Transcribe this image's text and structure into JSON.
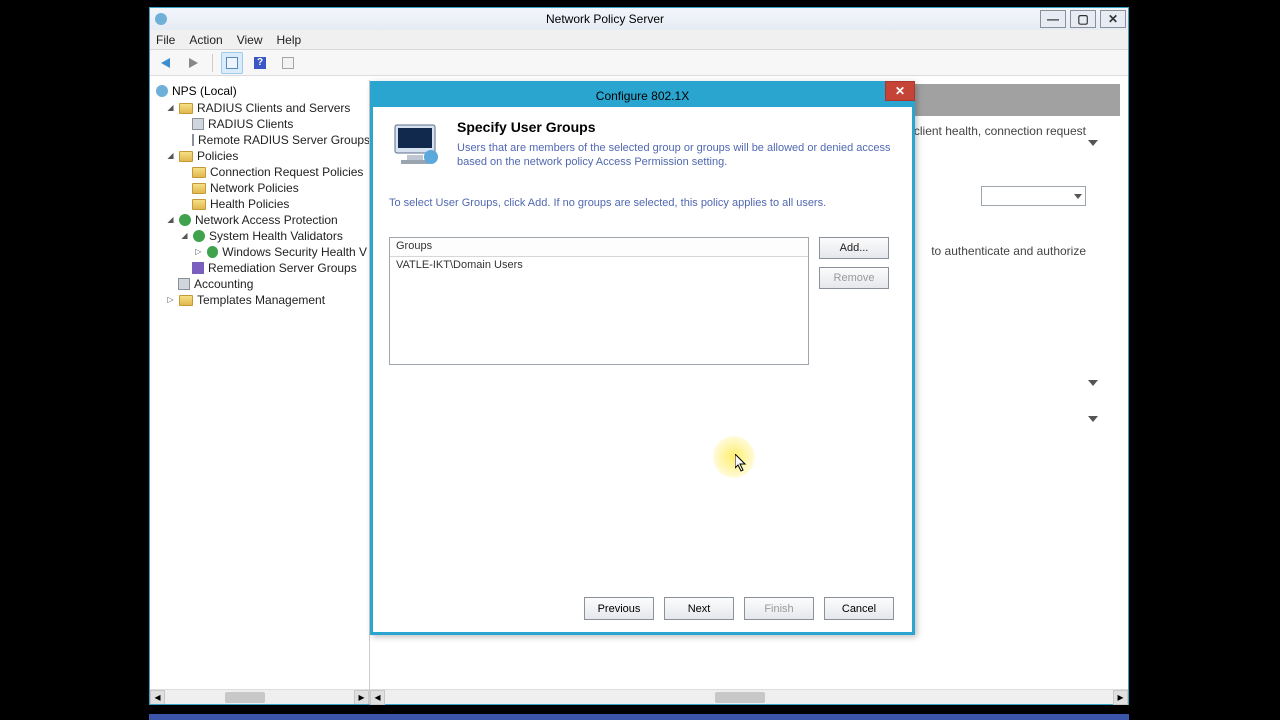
{
  "window": {
    "title": "Network Policy Server",
    "minimize": "—",
    "maximize": "▢",
    "close": "✕"
  },
  "menubar": [
    "File",
    "Action",
    "View",
    "Help"
  ],
  "tree": {
    "root": "NPS (Local)",
    "nodes": [
      {
        "label": "RADIUS Clients and Servers",
        "children": [
          {
            "label": "RADIUS Clients"
          },
          {
            "label": "Remote RADIUS Server Groups"
          }
        ]
      },
      {
        "label": "Policies",
        "children": [
          {
            "label": "Connection Request Policies"
          },
          {
            "label": "Network Policies"
          },
          {
            "label": "Health Policies"
          }
        ]
      },
      {
        "label": "Network Access Protection",
        "children": [
          {
            "label": "System Health Validators",
            "children": [
              {
                "label": "Windows Security Health V"
              }
            ]
          },
          {
            "label": "Remediation Server Groups"
          }
        ]
      },
      {
        "label": "Accounting"
      },
      {
        "label": "Templates Management"
      }
    ]
  },
  "main": {
    "text1_fragment": "client health, connection request",
    "text2_fragment": "to authenticate and authorize"
  },
  "dialog": {
    "title": "Configure 802.1X",
    "heading": "Specify User Groups",
    "description": "Users that are members of the selected group or groups will be allowed or denied access based on the network policy Access Permission setting.",
    "instruction": "To select User Groups, click Add. If no groups are selected, this policy applies to all users.",
    "list_header": "Groups",
    "list_items": [
      "VATLE-IKT\\Domain Users"
    ],
    "buttons": {
      "add": "Add...",
      "remove": "Remove"
    },
    "footer": {
      "previous": "Previous",
      "next": "Next",
      "finish": "Finish",
      "cancel": "Cancel"
    }
  }
}
